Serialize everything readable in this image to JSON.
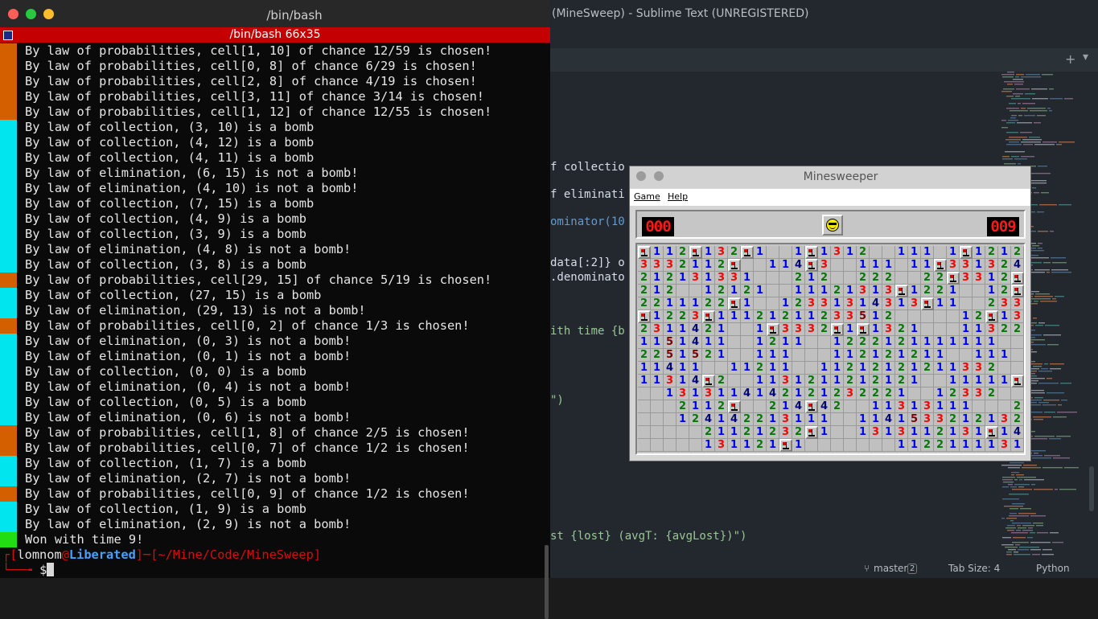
{
  "terminal": {
    "window_title": "/bin/bash",
    "tab_label": "/bin/bash 66x35",
    "lines": [
      {
        "text": "By law of probabilities, cell[1, 10] of chance 12/59 is chosen!",
        "tag": "probabilities"
      },
      {
        "text": "By law of probabilities, cell[0, 8] of chance 6/29 is chosen!",
        "tag": "probabilities"
      },
      {
        "text": "By law of probabilities, cell[2, 8] of chance 4/19 is chosen!",
        "tag": "probabilities"
      },
      {
        "text": "By law of probabilities, cell[3, 11] of chance 3/14 is chosen!",
        "tag": "probabilities"
      },
      {
        "text": "By law of probabilities, cell[1, 12] of chance 12/55 is chosen!",
        "tag": "probabilities"
      },
      {
        "text": "By law of collection, (3, 10) is a bomb",
        "tag": "logic"
      },
      {
        "text": "By law of collection, (4, 12) is a bomb",
        "tag": "logic"
      },
      {
        "text": "By law of collection, (4, 11) is a bomb",
        "tag": "logic"
      },
      {
        "text": "By law of elimination, (6, 15) is not a bomb!",
        "tag": "logic"
      },
      {
        "text": "By law of elimination, (4, 10) is not a bomb!",
        "tag": "logic"
      },
      {
        "text": "By law of collection, (7, 15) is a bomb",
        "tag": "logic"
      },
      {
        "text": "By law of collection, (4, 9) is a bomb",
        "tag": "logic"
      },
      {
        "text": "By law of collection, (3, 9) is a bomb",
        "tag": "logic"
      },
      {
        "text": "By law of elimination, (4, 8) is not a bomb!",
        "tag": "logic"
      },
      {
        "text": "By law of collection, (3, 8) is a bomb",
        "tag": "logic"
      },
      {
        "text": "By law of probabilities, cell[29, 15] of chance 5/19 is chosen!",
        "tag": "probabilities"
      },
      {
        "text": "By law of collection, (27, 15) is a bomb",
        "tag": "logic"
      },
      {
        "text": "By law of elimination, (29, 13) is not a bomb!",
        "tag": "logic"
      },
      {
        "text": "By law of probabilities, cell[0, 2] of chance 1/3 is chosen!",
        "tag": "probabilities"
      },
      {
        "text": "By law of elimination, (0, 3) is not a bomb!",
        "tag": "logic"
      },
      {
        "text": "By law of elimination, (0, 1) is not a bomb!",
        "tag": "logic"
      },
      {
        "text": "By law of collection, (0, 0) is a bomb",
        "tag": "logic"
      },
      {
        "text": "By law of elimination, (0, 4) is not a bomb!",
        "tag": "logic"
      },
      {
        "text": "By law of collection, (0, 5) is a bomb",
        "tag": "logic"
      },
      {
        "text": "By law of elimination, (0, 6) is not a bomb!",
        "tag": "logic"
      },
      {
        "text": "By law of probabilities, cell[1, 8] of chance 2/5 is chosen!",
        "tag": "probabilities"
      },
      {
        "text": "By law of probabilities, cell[0, 7] of chance 1/2 is chosen!",
        "tag": "probabilities"
      },
      {
        "text": "By law of collection, (1, 7) is a bomb",
        "tag": "logic"
      },
      {
        "text": "By law of elimination, (2, 7) is not a bomb!",
        "tag": "logic"
      },
      {
        "text": "By law of probabilities, cell[0, 9] of chance 1/2 is chosen!",
        "tag": "probabilities"
      },
      {
        "text": "By law of collection, (1, 9) is a bomb",
        "tag": "logic"
      },
      {
        "text": "By law of elimination, (2, 9) is not a bomb!",
        "tag": "logic"
      },
      {
        "text": "Won with time 9!",
        "tag": "won"
      }
    ],
    "prompt": {
      "user": "lomnom",
      "at": "@",
      "host": "Liberated",
      "path": "[~/Mine/Code/MineSweep]",
      "symbol": "$"
    },
    "colors": {
      "probabilities": "#d35f00",
      "logic": "#00e5ee",
      "won": "#22dd11",
      "prompt_red": "#d01010",
      "host": "#4aa0ff"
    }
  },
  "editor": {
    "window_title": "(MineSweep) - Sublime Text (UNREGISTERED)",
    "new_tab_icon": "+",
    "menu_icon": "chevron-down-icon",
    "code_fragments": [
      "f collectio",
      "f eliminati",
      "ominator(10",
      "data[:2]} o",
      ".denominato",
      "ith time {b",
      "\")",
      "st {lost} (avgT: {avgLost})\")"
    ],
    "status": {
      "branch": "master",
      "branch_count": "2",
      "tab_size": "Tab Size: 4",
      "syntax": "Python"
    }
  },
  "minesweeper": {
    "title": "Minesweeper",
    "menu": [
      "Game",
      "Help"
    ],
    "mines_counter": "000",
    "timer": "009",
    "face_icon": "sunglasses-smiley-icon",
    "number_colors": {
      "1": "#0000ff",
      "2": "#007b00",
      "3": "#ff0000",
      "4": "#00007b",
      "5": "#7b0000",
      "6": "#007b7b",
      "7": "#000000",
      "8": "#7b7b7b"
    },
    "board": [
      "F112F132F1  1F1312  111 1F12121F1F3131",
      "3332112F  114F3  111 11F3313241F12",
      "212131331   212  222  22F3312F1F33341",
      "212  12121  11121313F1221  12F2213",
      "2211122F1  12331314313F11  2334F13",
      "F1223F11121211233512     12F1312",
      "2311421  1F3332F1F1321   113221F1",
      "1151411  1211  1222121111111",
      "2251521  111   112121211  111",
      "11411  11211  11212121211332",
      "11314F2  1131211212121  11111F1",
      "  1313114142121232221  12332",
      "   2112F  214F42  11313111   211",
      "   124142213111  114153321213213",
      "     21121232F1  1313112131F1421",
      "     131121F1       11221111314F"
    ]
  }
}
